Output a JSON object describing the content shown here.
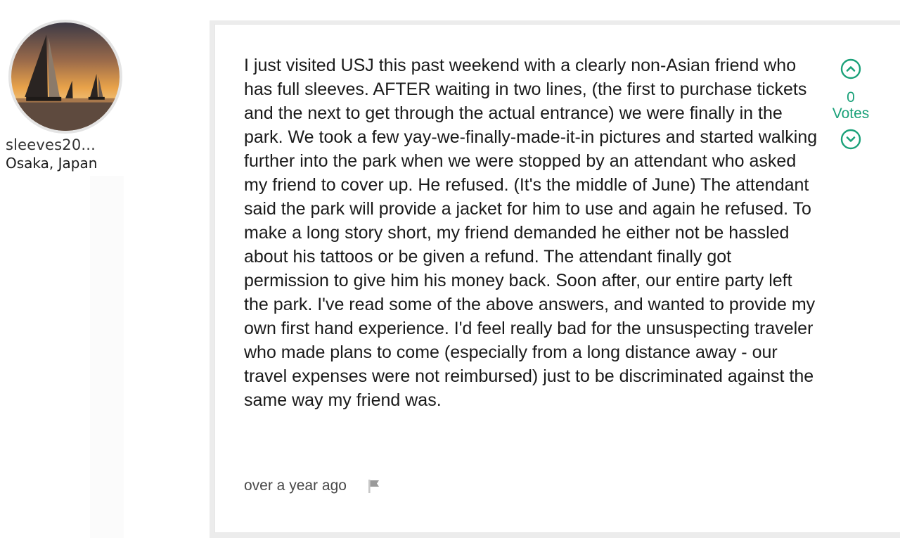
{
  "author": {
    "username": "sleeves20...",
    "location": "Osaka, Japan",
    "avatar_icon": "sailboat-sunset-avatar"
  },
  "answer": {
    "text": "I just visited USJ this past weekend with a clearly non-Asian friend who has full sleeves. AFTER waiting in two lines, (the first to purchase tickets and the next to get through the actual entrance) we were finally in the park. We took a few yay-we-finally-made-it-in pictures and started walking further into the park when we were stopped by an attendant who asked my friend to cover up. He refused. (It's the middle of June) The attendant said the park will provide a jacket for him to use and again he refused. To make a long story short, my friend demanded he either not be hassled about his tattoos or be given a refund. The attendant finally got permission to give him his money back. Soon after, our entire party left the park. I've read some of the above answers, and wanted to provide my own first hand experience. I'd feel really bad for the unsuspecting traveler who made plans to come (especially from a long distance away - our travel expenses were not reimbursed) just to be discriminated against the same way my friend was.",
    "timestamp": "over a year ago",
    "flag_icon": "flag-icon"
  },
  "votes": {
    "count": "0",
    "label": "Votes",
    "upvote_icon": "chevron-up-circle-icon",
    "downvote_icon": "chevron-down-circle-icon",
    "accent_color": "#1aa179"
  }
}
